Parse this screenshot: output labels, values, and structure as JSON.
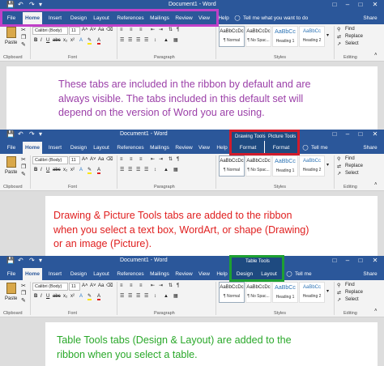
{
  "app": {
    "window_title": "Document1 - Word",
    "tell_me": "Tell me what you want to do",
    "tell_me_short": "Tell me",
    "share": "Share"
  },
  "tabs": [
    "File",
    "Home",
    "Insert",
    "Design",
    "Layout",
    "References",
    "Mailings",
    "Review",
    "View",
    "Help"
  ],
  "contextual": {
    "drawing_group": "Drawing Tools",
    "picture_group": "Picture Tools",
    "format_label": "Format",
    "table_group": "Table Tools",
    "design_label": "Design",
    "layout_label": "Layout"
  },
  "ribbon": {
    "paste": "Paste",
    "clipboard": "Clipboard",
    "font_name": "Calibri (Body)",
    "font_size": "11",
    "font_group": "Font",
    "paragraph_group": "Paragraph",
    "styles_group": "Styles",
    "editing_group": "Editing",
    "find": "Find",
    "replace": "Replace",
    "select": "Select",
    "bold": "B",
    "italic": "I",
    "underline": "U",
    "styles": [
      {
        "preview": "AaBbCcDc",
        "name": "¶ Normal"
      },
      {
        "preview": "AaBbCcDc",
        "name": "¶ No Spac..."
      },
      {
        "preview": "AaBbCc",
        "name": "Heading 1"
      },
      {
        "preview": "AaBbCc",
        "name": "Heading 2"
      }
    ]
  },
  "messages": {
    "panel1": [
      "These tabs are included in the ribbon by default and are",
      "always visible. The tabs included in this default set will",
      "depend on the version of Word you are using."
    ],
    "panel2": [
      "Drawing & Picture Tools tabs are added to the ribbon",
      "when you select a text box, WordArt, or shape (Drawing)",
      "or an image (Picture)."
    ],
    "panel3": [
      "Table Tools tabs (Design & Layout) are added to the",
      "ribbon when you select a table."
    ]
  },
  "colors": {
    "word_blue": "#2b579a",
    "purple_text": "#9b3fa8",
    "purple_border": "#c040c8",
    "red_text": "#e02020",
    "red_border": "#d01c2c",
    "green_text": "#2aa82a",
    "green_border": "#1ea032"
  }
}
